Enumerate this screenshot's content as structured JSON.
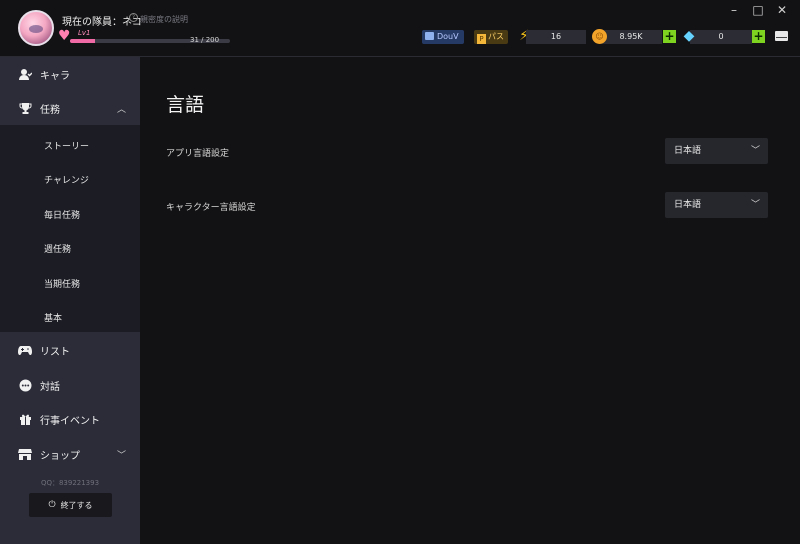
{
  "header": {
    "team_title": "現在の隊員：ネコ",
    "help_link": "親密度の説明",
    "level_label": "Lv1",
    "xp_text": "31 / 200",
    "xp_fraction": 0.155,
    "douv_label": "DouV",
    "pass_label": "パス",
    "pass_icon_letter": "P",
    "energy_value": "16",
    "coin_value": "8.95K",
    "gem_value": "0",
    "plus_symbol": "+",
    "accent_color": "#f06aa6",
    "plus_color": "#7ed321"
  },
  "window_controls": [
    "–",
    "□",
    "✕"
  ],
  "sidebar": {
    "items": [
      {
        "label": "キャラ",
        "icon": "user-icon"
      },
      {
        "label": "任務",
        "icon": "trophy-icon",
        "expanded": true
      },
      {
        "label": "リスト",
        "icon": "gamepad-icon"
      },
      {
        "label": "対話",
        "icon": "chat-icon"
      },
      {
        "label": "行事イベント",
        "icon": "gift-icon"
      },
      {
        "label": "ショップ",
        "icon": "shop-icon",
        "expanded": false
      }
    ],
    "sub_items": [
      "ストーリー",
      "チャレンジ",
      "毎日任務",
      "週任務",
      "当期任務",
      "基本"
    ],
    "qq": "QQ：839221393",
    "logout_label": "終了する"
  },
  "main": {
    "title": "言語",
    "rows": [
      {
        "label": "アプリ言語設定",
        "value": "日本語"
      },
      {
        "label": "キャラクター言語設定",
        "value": "日本語"
      }
    ]
  }
}
